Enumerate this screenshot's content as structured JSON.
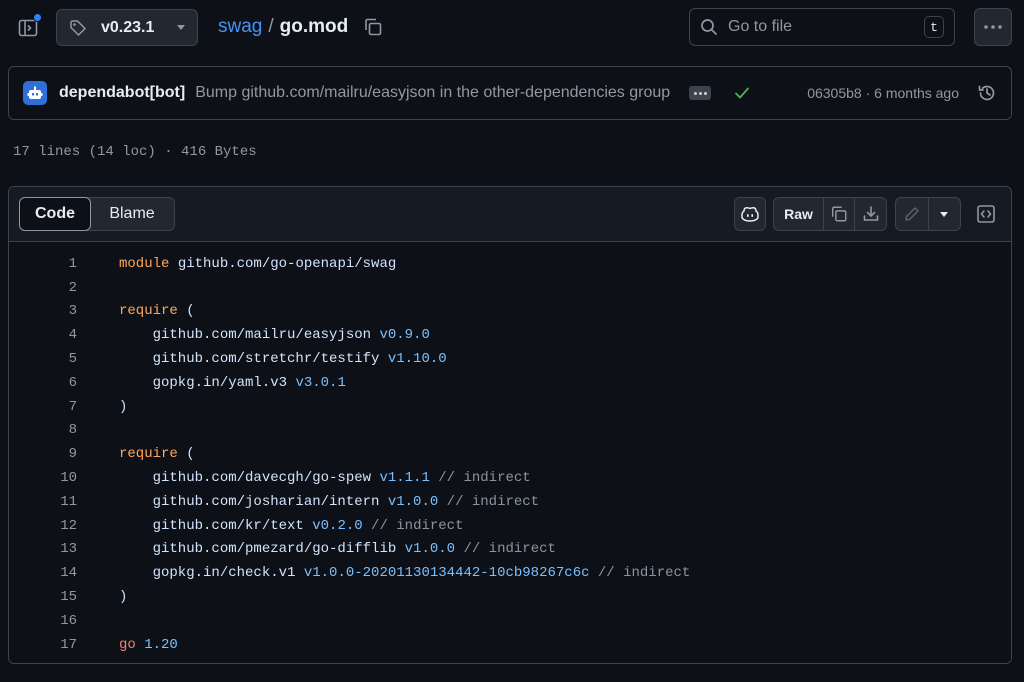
{
  "header": {
    "branch": "v0.23.1",
    "repo": "swag",
    "separator": "/",
    "file": "go.mod",
    "search_placeholder": "Go to file",
    "search_shortcut": "t"
  },
  "commit": {
    "author": "dependabot[bot]",
    "message": "Bump github.com/mailru/easyjson in the other-dependencies group",
    "sha": "06305b8",
    "meta_sep": " · ",
    "time": "6 months ago"
  },
  "file_stats": "17 lines (14 loc) · 416 Bytes",
  "code_view": {
    "tab_code": "Code",
    "tab_blame": "Blame",
    "raw_label": "Raw"
  },
  "code_lines": [
    {
      "n": "1",
      "a": "module",
      "b": " github.com/go-openapi/swag",
      "v": "",
      "c": ""
    },
    {
      "n": "2",
      "a": "",
      "b": "",
      "v": "",
      "c": ""
    },
    {
      "n": "3",
      "a": "require",
      "b": " (",
      "v": "",
      "c": ""
    },
    {
      "n": "4",
      "a": "",
      "b": "    github.com/mailru/easyjson ",
      "v": "v0.9.0",
      "c": ""
    },
    {
      "n": "5",
      "a": "",
      "b": "    github.com/stretchr/testify ",
      "v": "v1.10.0",
      "c": ""
    },
    {
      "n": "6",
      "a": "",
      "b": "    gopkg.in/yaml.v3 ",
      "v": "v3.0.1",
      "c": ""
    },
    {
      "n": "7",
      "a": "",
      "b": ")",
      "v": "",
      "c": ""
    },
    {
      "n": "8",
      "a": "",
      "b": "",
      "v": "",
      "c": ""
    },
    {
      "n": "9",
      "a": "require",
      "b": " (",
      "v": "",
      "c": ""
    },
    {
      "n": "10",
      "a": "",
      "b": "    github.com/davecgh/go-spew ",
      "v": "v1.1.1",
      "c": " // indirect"
    },
    {
      "n": "11",
      "a": "",
      "b": "    github.com/josharian/intern ",
      "v": "v1.0.0",
      "c": " // indirect"
    },
    {
      "n": "12",
      "a": "",
      "b": "    github.com/kr/text ",
      "v": "v0.2.0",
      "c": " // indirect"
    },
    {
      "n": "13",
      "a": "",
      "b": "    github.com/pmezard/go-difflib ",
      "v": "v1.0.0",
      "c": " // indirect"
    },
    {
      "n": "14",
      "a": "",
      "b": "    gopkg.in/check.v1 ",
      "v": "v1.0.0-20201130134442-10cb98267c6c",
      "c": " // indirect"
    },
    {
      "n": "15",
      "a": "",
      "b": ")",
      "v": "",
      "c": ""
    },
    {
      "n": "16",
      "a": "",
      "b": "",
      "v": "",
      "c": ""
    },
    {
      "n": "17",
      "a": "go",
      "b": " ",
      "v": "1.20",
      "c": ""
    }
  ],
  "icons": {
    "sidebar": "sidebar-expand-icon",
    "tag": "tag-icon",
    "copy": "copy-icon",
    "search": "search-icon",
    "kebab": "kebab-horizontal-icon",
    "bot": "dependabot-icon",
    "check": "check-icon",
    "history": "history-icon",
    "copilot": "copilot-icon",
    "download": "download-icon",
    "pencil": "pencil-icon",
    "symbols": "code-square-icon"
  },
  "colors": {
    "background": "#0d1117",
    "link": "#4493f8",
    "keyword": "#ff7b72",
    "keyword_orange": "#ffa657",
    "version": "#79c0ff",
    "comment": "#8b949e",
    "success": "#3fb950"
  }
}
